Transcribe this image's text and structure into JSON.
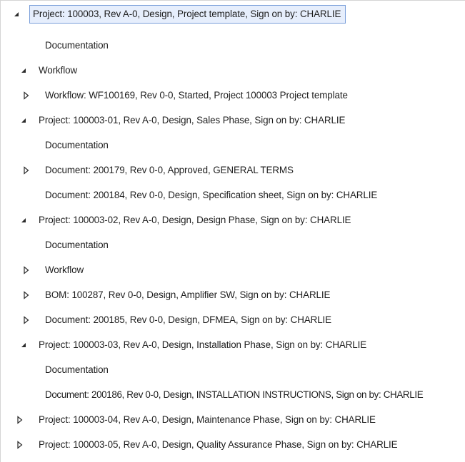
{
  "tree": {
    "nodes": [
      {
        "label": "Project: 100003, Rev A-0, Design, Project template, Sign on by: CHARLIE",
        "level": 0,
        "state": "expanded",
        "selected": true
      },
      {
        "label": "Documentation",
        "level": 1,
        "state": "leaf"
      },
      {
        "label": "Workflow",
        "level": 1,
        "state": "expanded"
      },
      {
        "label": "Workflow: WF100169, Rev 0-0, Started, Project 100003 Project template",
        "level": 1,
        "state": "collapsed"
      },
      {
        "label": "Project: 100003-01, Rev A-0, Design, Sales Phase, Sign on by: CHARLIE",
        "level": 1,
        "state": "expanded"
      },
      {
        "label": "Documentation",
        "level": 1,
        "state": "leaf"
      },
      {
        "label": "Document: 200179, Rev 0-0, Approved, GENERAL TERMS",
        "level": 1,
        "state": "collapsed"
      },
      {
        "label": "Document: 200184, Rev 0-0, Design, Specification sheet, Sign on by: CHARLIE",
        "level": 1,
        "state": "leaf"
      },
      {
        "label": "Project: 100003-02, Rev A-0, Design, Design Phase, Sign on by: CHARLIE",
        "level": 1,
        "state": "expanded"
      },
      {
        "label": "Documentation",
        "level": 1,
        "state": "leaf"
      },
      {
        "label": "Workflow",
        "level": 1,
        "state": "collapsed"
      },
      {
        "label": "BOM: 100287, Rev 0-0, Design, Amplifier SW, Sign on by: CHARLIE",
        "level": 1,
        "state": "collapsed"
      },
      {
        "label": "Document: 200185, Rev 0-0, Design, DFMEA, Sign on by: CHARLIE",
        "level": 1,
        "state": "collapsed"
      },
      {
        "label": "Project: 100003-03, Rev A-0, Design, Installation Phase, Sign on by: CHARLIE",
        "level": 1,
        "state": "expanded"
      },
      {
        "label": "Documentation",
        "level": 1,
        "state": "leaf"
      },
      {
        "label": "Document: 200186, Rev 0-0, Design, INSTALLATION INSTRUCTIONS, Sign on by: CHARLIE",
        "level": 1,
        "state": "leaf"
      },
      {
        "label": "Project: 100003-04, Rev A-0, Design, Maintenance Phase, Sign on by: CHARLIE",
        "level": 1,
        "state": "collapsed"
      },
      {
        "label": "Project: 100003-05, Rev A-0, Design, Quality Assurance Phase, Sign on by: CHARLIE",
        "level": 1,
        "state": "collapsed"
      }
    ]
  },
  "icons": {
    "expanded": "expanded-triangle-icon",
    "collapsed": "collapsed-triangle-icon"
  },
  "colors": {
    "selection_fill": "#e6eefc",
    "selection_border": "#7a9fd9",
    "text": "#1e1e1e",
    "glyph": "#2b2b2b"
  }
}
